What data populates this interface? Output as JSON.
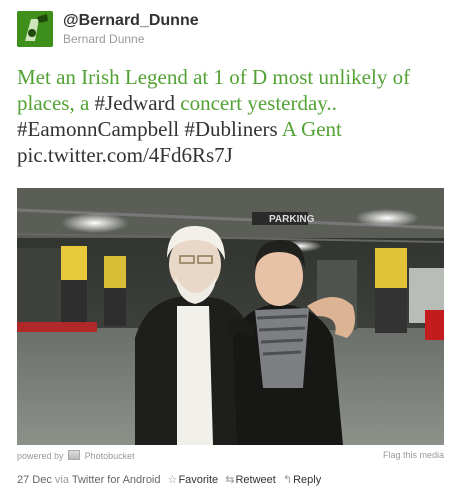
{
  "user": {
    "handle": "@Bernard_Dunne",
    "name": "Bernard Dunne"
  },
  "tweet": {
    "seg1": "Met an Irish Legend at 1 of D most unlikely of places, a ",
    "tag1": "#Jedward",
    "seg2": " concert yesterday.. ",
    "tag2": "#EamonnCampbell",
    "tag3": "#Dubliners",
    "seg3": " A Gent ",
    "link": "pic.twitter.com/4Fd6Rs7J"
  },
  "photo": {
    "sign_text": "PARKING"
  },
  "media_footer": {
    "powered_by": "powered by",
    "provider": "Photobucket",
    "flag": "Flag this media"
  },
  "meta": {
    "date": "27 Dec",
    "via": "via",
    "client": "Twitter for Android",
    "favorite": "Favorite",
    "retweet": "Retweet",
    "reply": "Reply"
  },
  "colors": {
    "tweet_text": "#52a236",
    "hashtag": "#333333",
    "meta": "#999999"
  }
}
